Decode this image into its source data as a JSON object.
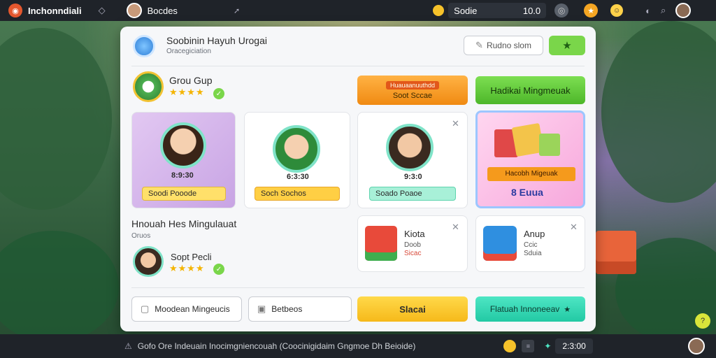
{
  "topbar": {
    "app_title": "Inchonndiali",
    "user_name": "Bocdes",
    "coin_label": "Sodie",
    "coin_value": "10.0"
  },
  "header": {
    "title": "Soobinin Hayuh Urogai",
    "subtitle": "Oracegiciation",
    "secondary_button": "Rudno slom"
  },
  "group": {
    "name": "Grou Gup",
    "stars": "★★★★"
  },
  "banner": {
    "label": "Huauaanuuthdd",
    "sub_label": "Soot Sccae"
  },
  "green_button": "Hadikai Mingmeuak",
  "avatars": [
    {
      "price": "8:9:30",
      "chip": "Soodi  Pooode"
    },
    {
      "price": "6:3:30",
      "chip": "Soch  Sochos"
    },
    {
      "price": "9:3:0",
      "chip": "Soado  Poaoe"
    }
  ],
  "promo": {
    "banner": "Hacobh Migeuak",
    "price": "8 Euua"
  },
  "section": {
    "title": "Hnouah Hes Mingulauat",
    "subtitle": "Oruos"
  },
  "user": {
    "name": "Sopt Pecli",
    "stars": "★★★★"
  },
  "items": [
    {
      "title": "Kiota",
      "line1": "Doob",
      "line2": "Sicac"
    },
    {
      "title": "Anup",
      "line1": "Ccic",
      "line2": "Sduia"
    }
  ],
  "footer_buttons": {
    "b1": "Moodean Mingeucis",
    "b2": "Betbeos",
    "primary": "Slacai",
    "teal": "Flatuah Innoneeav"
  },
  "bottombar": {
    "status": "Gofo Ore Indeuain Inocimgniencouah (Coocinigidaim Gngmoe Dh Beioide)",
    "count": "2:3:00"
  },
  "colors": {
    "orange": "#f59a1c",
    "green": "#5fc83a",
    "teal": "#2fd3b0",
    "yellow": "#ffcf2e"
  }
}
